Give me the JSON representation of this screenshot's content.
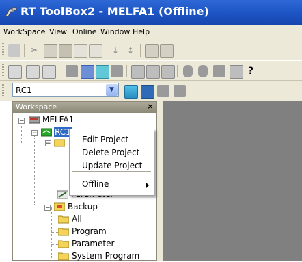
{
  "window": {
    "title": "RT ToolBox2 - MELFA1  (Offline)"
  },
  "menubar": {
    "items": [
      "WorkSpace",
      "View",
      "Online",
      "Window",
      "Help"
    ]
  },
  "robot_selector": {
    "value": "RC1"
  },
  "workspace": {
    "title": "Workspace",
    "close": "×",
    "tree": {
      "root": "MELFA1",
      "robot": "RC1",
      "parameter": "Parameter",
      "backup": "Backup",
      "backup_children": [
        "All",
        "Program",
        "Parameter",
        "System Program"
      ]
    }
  },
  "context_menu": {
    "items": [
      "Edit Project",
      "Delete Project",
      "Update Project"
    ],
    "submenu": "Offline"
  },
  "colors": {
    "titlebar": "#2563d1",
    "workspace_header": "#9e9a88",
    "client_area": "#808080",
    "robot_icon": "#2aa52a",
    "folder": "#f3d35a"
  }
}
